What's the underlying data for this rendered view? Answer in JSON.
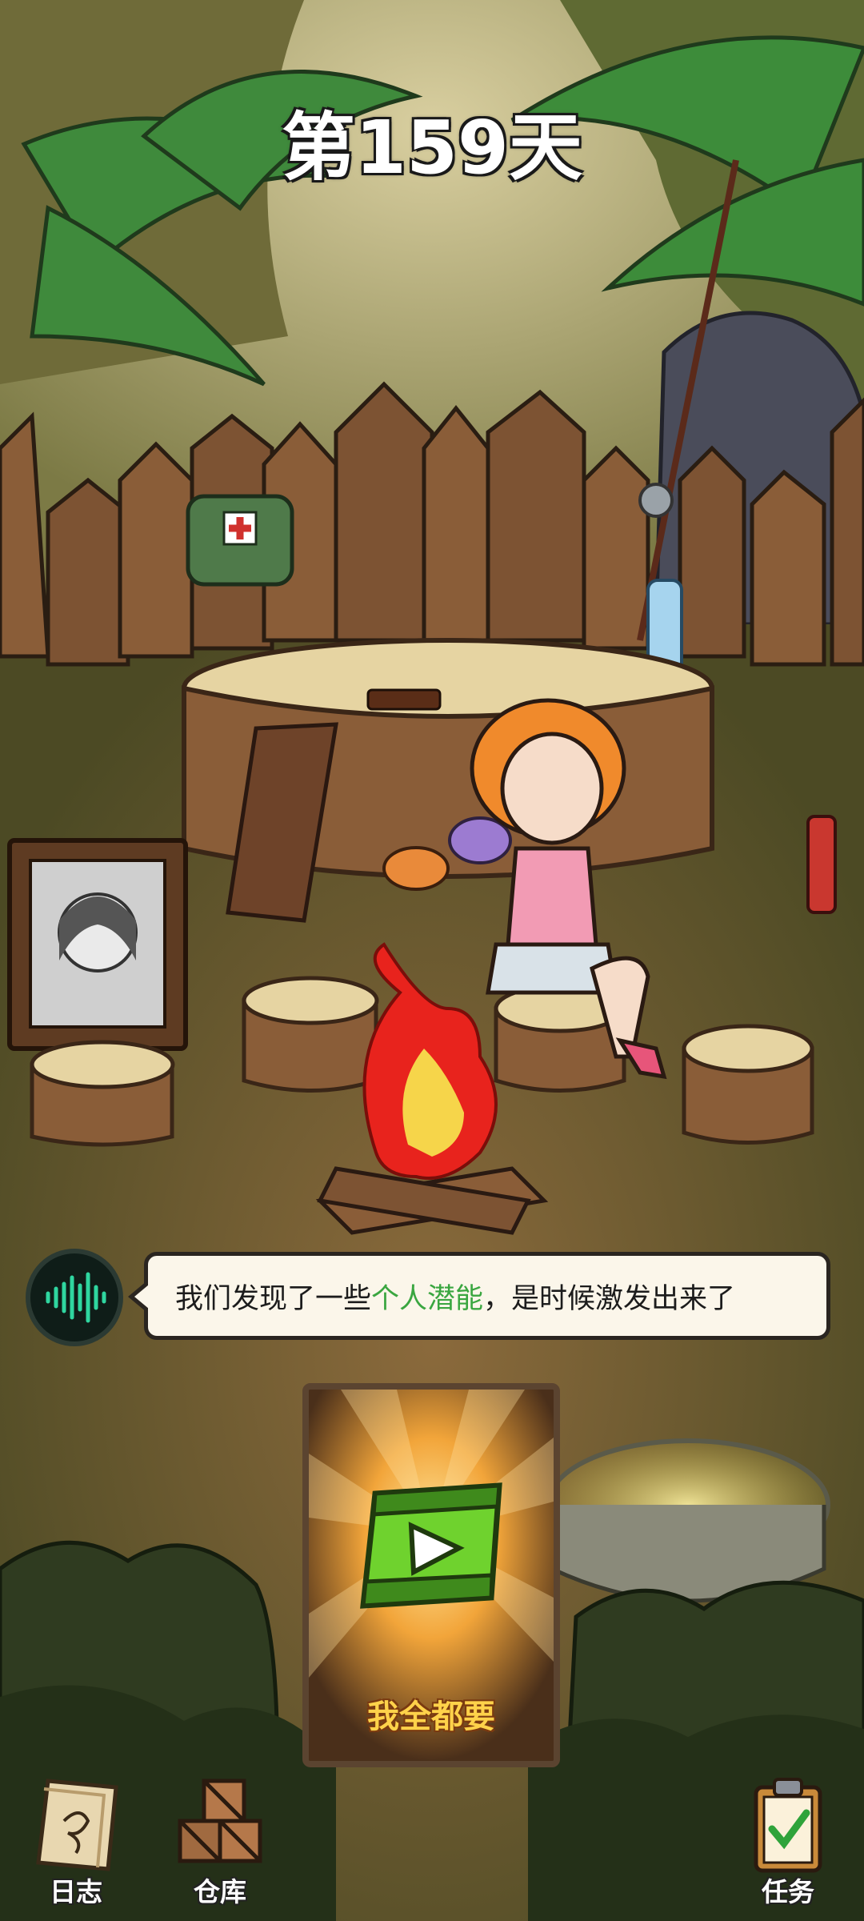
{
  "day_title": "第159天",
  "dialog": {
    "text_before": "我们发现了一些",
    "text_highlight": "个人潜能",
    "text_after": "，是时候激发出来了",
    "icon": "voice-wave-icon"
  },
  "reward_card": {
    "label": "我全都要",
    "icon": "video-play-icon"
  },
  "bottom_nav": {
    "log": {
      "label": "日志",
      "icon": "notebook-icon"
    },
    "storage": {
      "label": "仓库",
      "icon": "crates-icon"
    },
    "tasks": {
      "label": "任务",
      "icon": "clipboard-icon"
    }
  },
  "colors": {
    "highlight": "#3aa640",
    "voice_wave": "#2fd6a0",
    "card_label": "#ffd24a",
    "video_icon": "#6fd22e"
  }
}
